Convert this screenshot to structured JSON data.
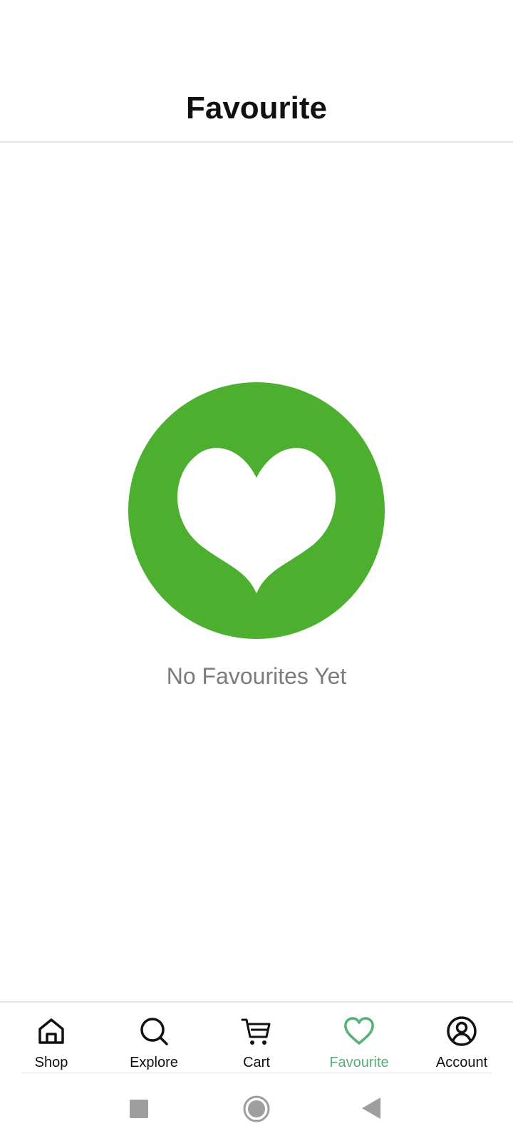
{
  "header": {
    "title": "Favourite"
  },
  "empty_state": {
    "icon": "heart-icon",
    "icon_background": "#4caf2f",
    "message": "No Favourites Yet"
  },
  "bottom_nav": {
    "active_color": "#53b175",
    "items": [
      {
        "label": "Shop",
        "icon": "home-icon",
        "active": false
      },
      {
        "label": "Explore",
        "icon": "search-icon",
        "active": false
      },
      {
        "label": "Cart",
        "icon": "cart-icon",
        "active": false
      },
      {
        "label": "Favourite",
        "icon": "heart-outline-icon",
        "active": true
      },
      {
        "label": "Account",
        "icon": "account-icon",
        "active": false
      }
    ]
  },
  "system_nav": {
    "buttons": [
      "recents-button",
      "home-button",
      "back-button"
    ]
  }
}
